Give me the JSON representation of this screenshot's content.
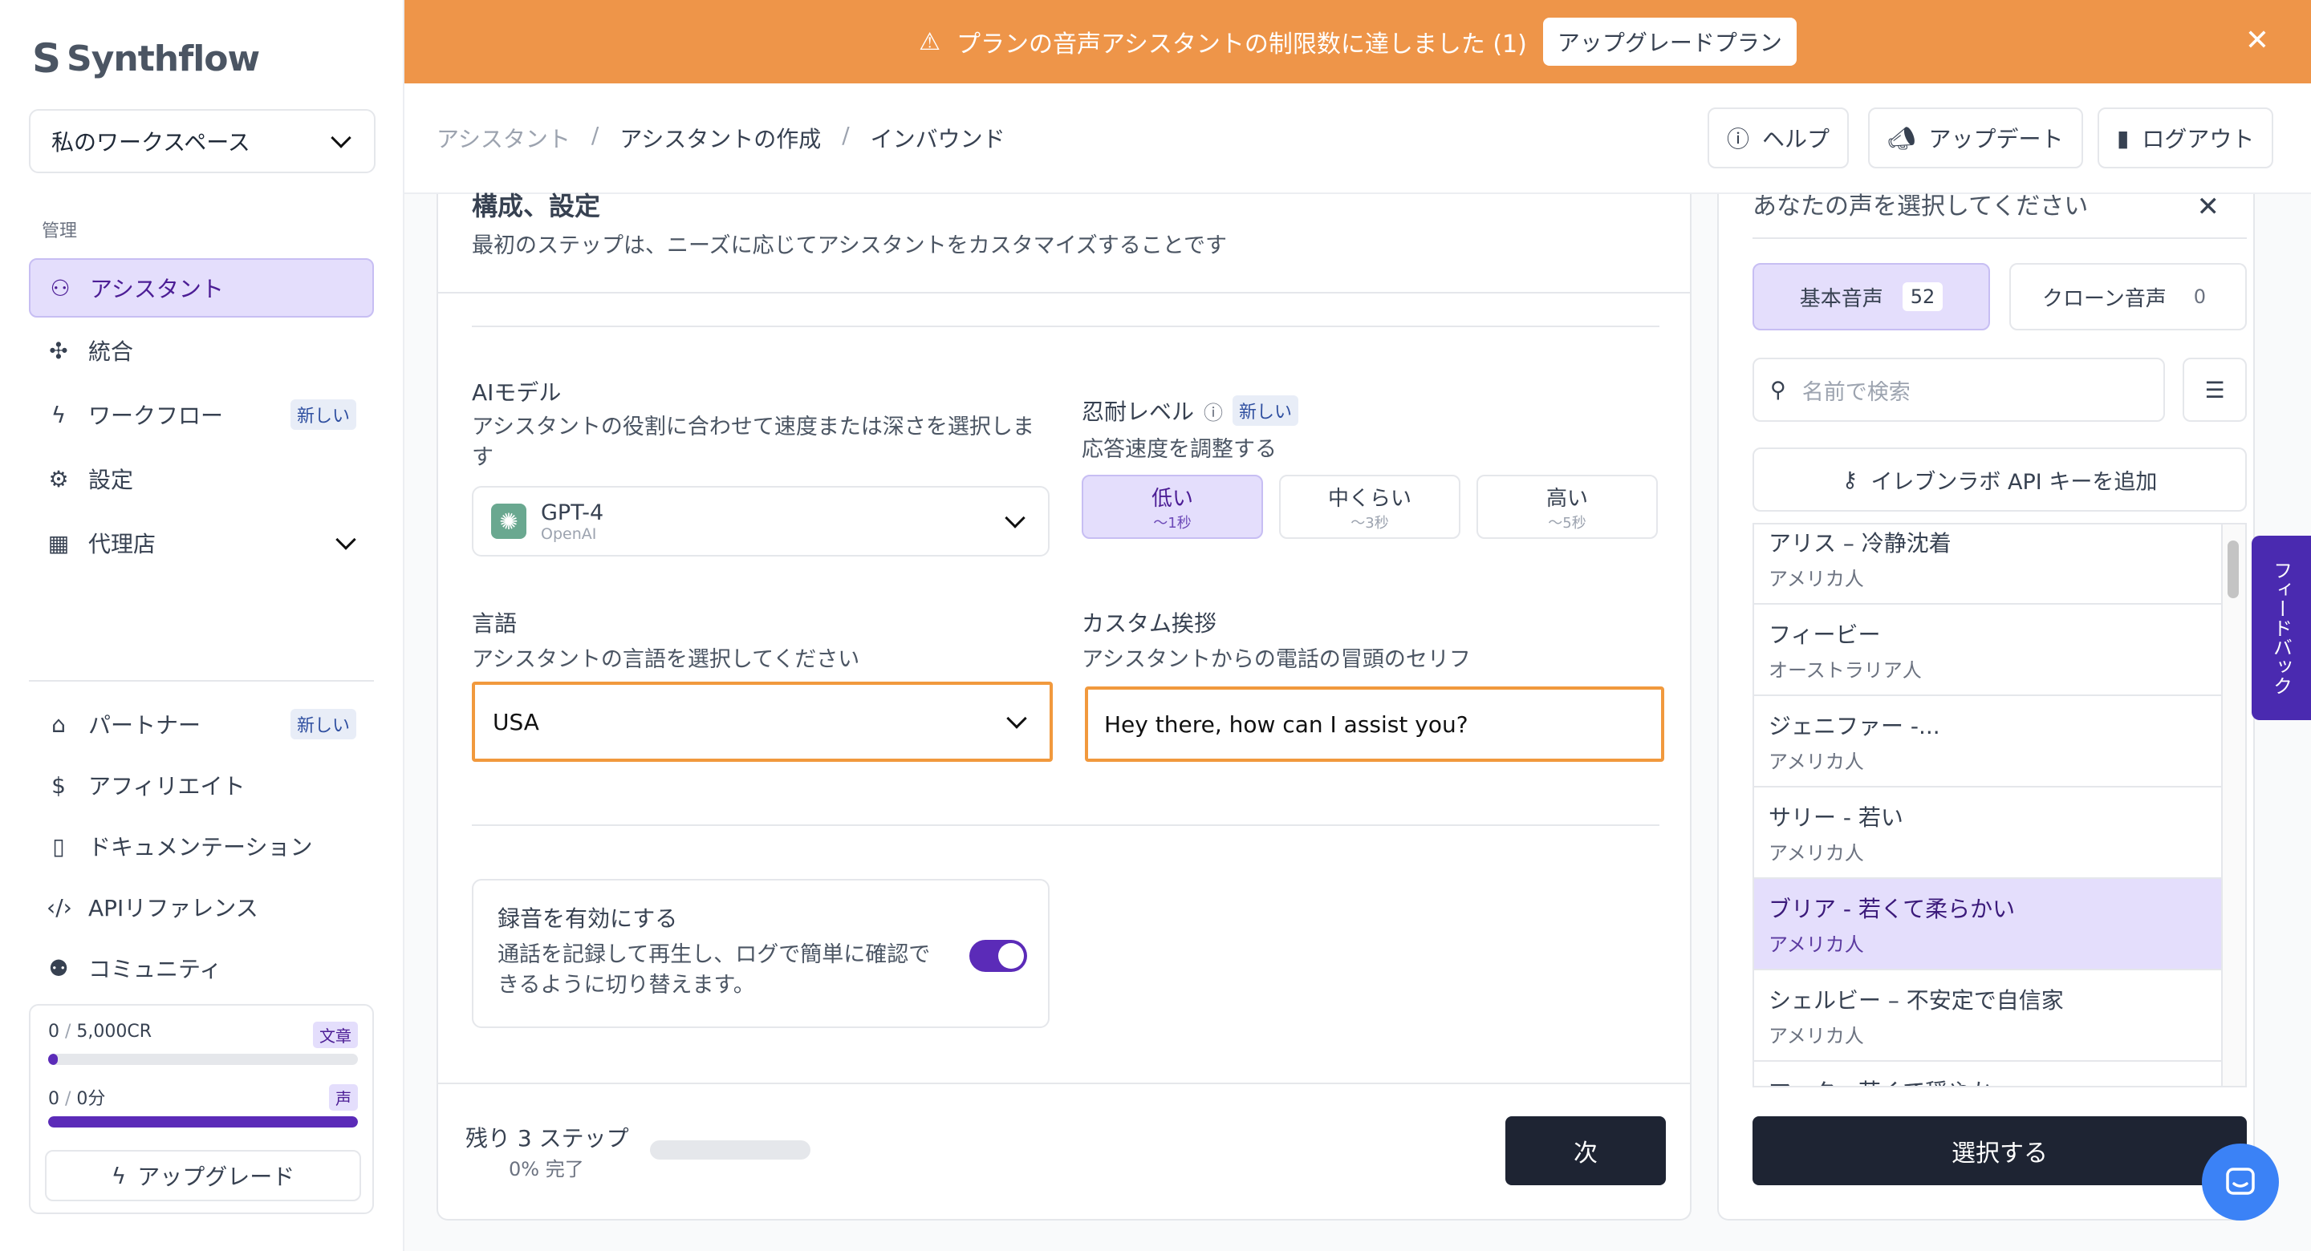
{
  "app": {
    "logo_text": "Synthflow"
  },
  "sidebar": {
    "workspace": "私のワークスペース",
    "section_label": "管理",
    "items": [
      {
        "label": "アシスタント",
        "icon": "user-plus-icon"
      },
      {
        "label": "統合",
        "icon": "puzzle-icon"
      },
      {
        "label": "ワークフロー",
        "icon": "bolt-icon",
        "badge": "新しい"
      },
      {
        "label": "設定",
        "icon": "gear-icon"
      },
      {
        "label": "代理店",
        "icon": "building-icon"
      }
    ],
    "lower_items": [
      {
        "label": "パートナー",
        "icon": "store-icon",
        "badge": "新しい"
      },
      {
        "label": "アフィリエイト",
        "icon": "dollar-icon"
      },
      {
        "label": "ドキュメンテーション",
        "icon": "document-icon"
      },
      {
        "label": "APIリファレンス",
        "icon": "code-icon"
      },
      {
        "label": "コミュニティ",
        "icon": "users-icon"
      }
    ],
    "usage": {
      "text_used": "0",
      "text_total": "5,000CR",
      "text_tag": "文章",
      "text_fill": 0.03,
      "voice_used": "0",
      "voice_total": "0分",
      "voice_tag": "声",
      "voice_fill": 1.0,
      "upgrade_label": "アップグレード"
    }
  },
  "banner": {
    "message": "プランの音声アシスタントの制限数に達しました (1)",
    "button": "アップグレードプラン"
  },
  "header": {
    "breadcrumbs": [
      "アシスタント",
      "アシスタントの作成",
      "インバウンド"
    ],
    "help": "ヘルプ",
    "updates": "アップデート",
    "logout": "ログアウト"
  },
  "form": {
    "title": "構成、設定",
    "subtitle": "最初のステップは、ニーズに応じてアシスタントをカスタマイズすることです",
    "model_label": "AIモデル",
    "model_desc": "アシスタントの役割に合わせて速度または深さを選択します",
    "model_name": "GPT-4",
    "model_provider": "OpenAI",
    "patience_label": "忍耐レベル",
    "patience_badge": "新しい",
    "patience_desc": "応答速度を調整する",
    "patience_options": [
      {
        "label": "低い",
        "sub": "〜1秒"
      },
      {
        "label": "中くらい",
        "sub": "〜3秒"
      },
      {
        "label": "高い",
        "sub": "〜5秒"
      }
    ],
    "language_label": "言語",
    "language_desc": "アシスタントの言語を選択してください",
    "language_value": "USA",
    "greeting_label": "カスタム挨拶",
    "greeting_desc": "アシスタントからの電話の冒頭のセリフ",
    "greeting_value": "Hey there, how can I assist you?",
    "recording_label": "録音を有効にする",
    "recording_desc": "通話を記録して再生し、ログで簡単に確認できるように切り替えます。",
    "steps_left": "残り 3 ステップ",
    "progress": "0% 完了",
    "next": "次"
  },
  "voice_panel": {
    "title": "あなたの声を選択してください",
    "tab_basic": "基本音声",
    "tab_basic_count": "52",
    "tab_clone": "クローン音声",
    "tab_clone_count": "0",
    "search_placeholder": "名前で検索",
    "elevenlabs": "イレブンラボ API キーを追加",
    "voices": [
      {
        "name": "アリス – 冷静沈着",
        "country": "アメリカ人"
      },
      {
        "name": "フィービー",
        "country": "オーストラリア人"
      },
      {
        "name": "ジェニファー -...",
        "country": "アメリカ人"
      },
      {
        "name": "サリー - 若い",
        "country": "アメリカ人"
      },
      {
        "name": "ブリア - 若くて柔らかい",
        "country": "アメリカ人"
      },
      {
        "name": "シェルビー – 不安定で自信家",
        "country": "アメリカ人"
      },
      {
        "name": "マーク - 若くて穏やか",
        "country": ""
      }
    ],
    "choose": "選択する"
  },
  "feedback": "フィードバック"
}
